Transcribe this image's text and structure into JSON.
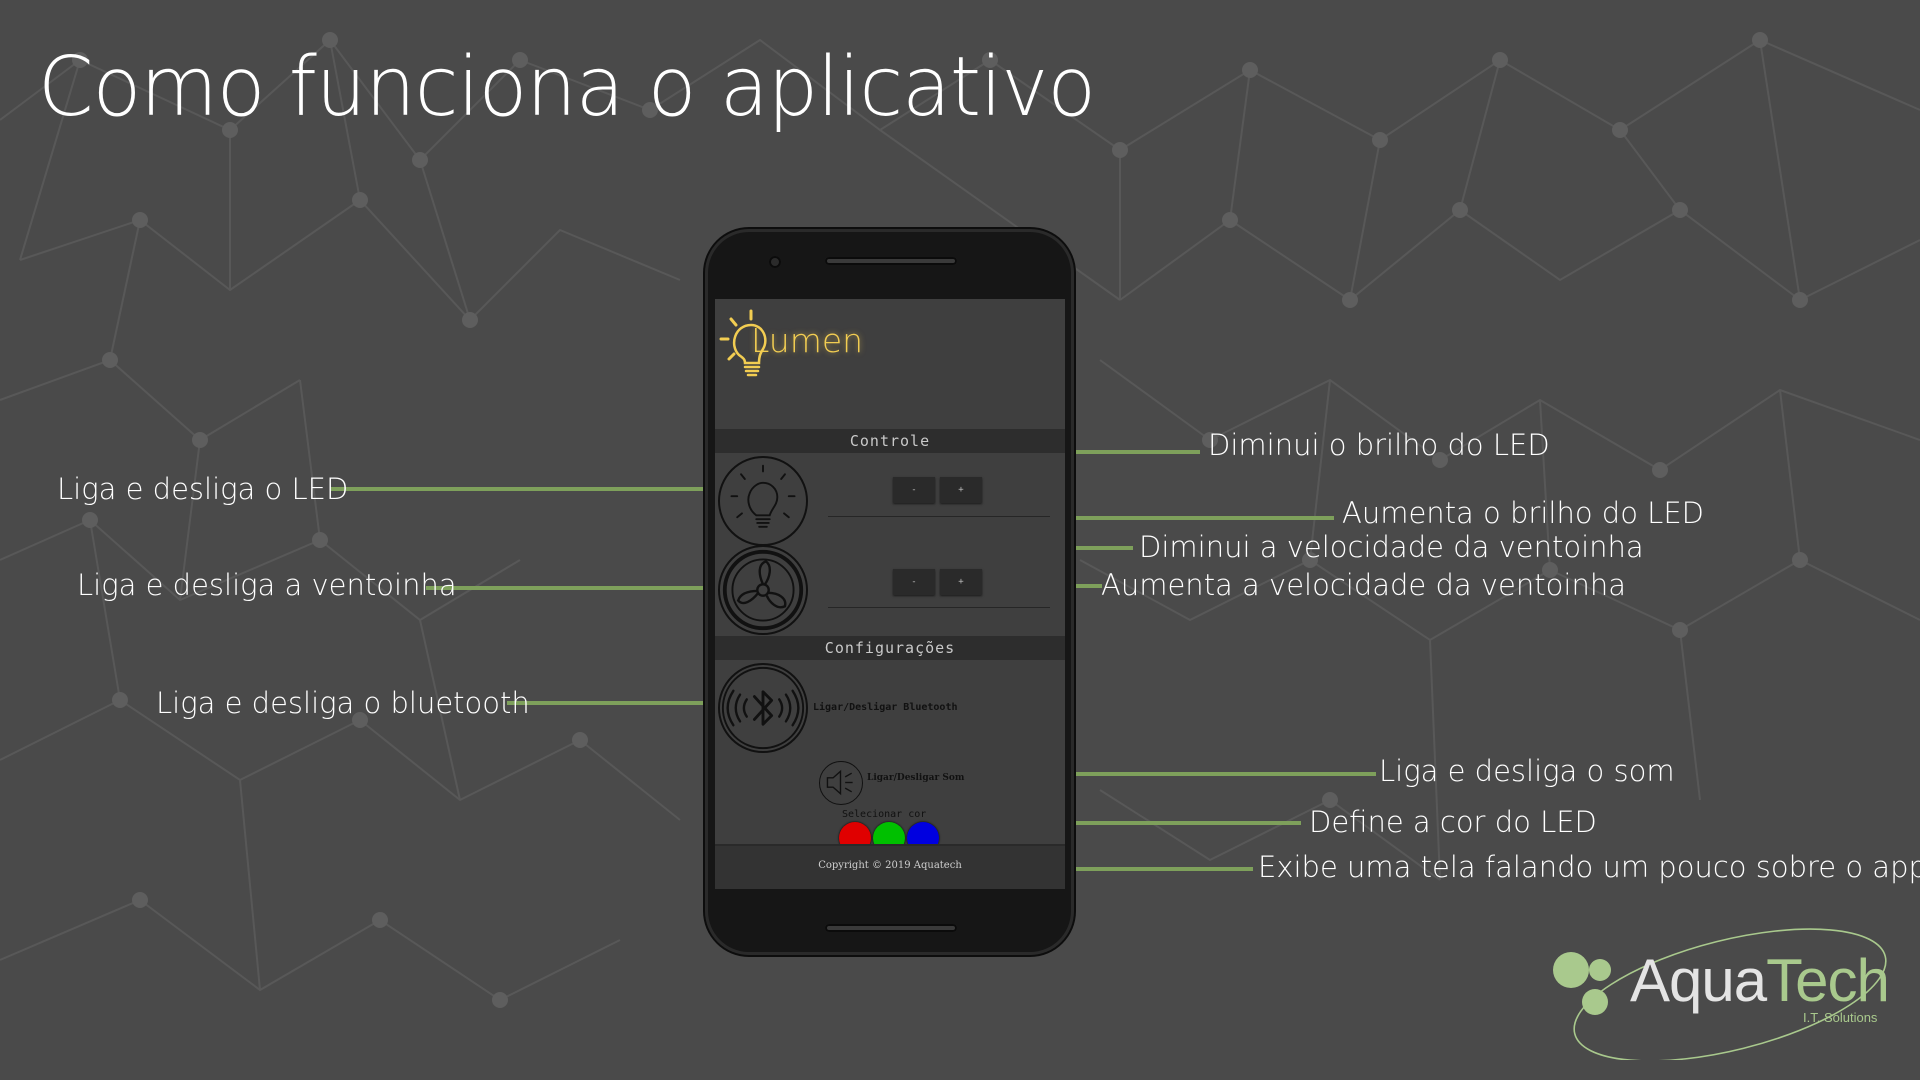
{
  "slide": {
    "title": "Como funciona o aplicativo",
    "accent_color": "#7ea05b"
  },
  "annotations": {
    "led_toggle": "Liga e desliga o LED",
    "fan_toggle": "Liga e desliga a ventoinha",
    "bluetooth_toggle": "Liga e desliga o bluetooth",
    "led_decrease": "Diminui o brilho do LED",
    "led_increase": "Aumenta o brilho do LED",
    "fan_decrease": "Diminui a velocidade da ventoinha",
    "fan_increase": "Aumenta a velocidade da ventoinha",
    "sound_toggle": "Liga e desliga o som",
    "color_select": "Define a cor do LED",
    "about_screen": "Exibe uma tela falando um pouco sobre o app"
  },
  "app": {
    "name": "Lumen",
    "logo_color": "#f2cd52",
    "sections": {
      "control": "Controle",
      "settings": "Configurações"
    },
    "led_buttons": {
      "minus": "-",
      "plus": "+"
    },
    "fan_buttons": {
      "minus": "-",
      "plus": "+"
    },
    "bluetooth_label": "Ligar/Desligar Bluetooth",
    "sound_label": "Ligar/Desligar Som",
    "color_label": "Selecionar cor",
    "colors": [
      "#e00000",
      "#00c000",
      "#0000e0"
    ],
    "footer": "Copyright © 2019 Aquatech",
    "icons": [
      "lightbulb-icon",
      "fan-icon",
      "bluetooth-icon",
      "speaker-icon"
    ]
  },
  "brand": {
    "name_part1": "Aqua",
    "name_part2": "Tech",
    "tagline": "I.T. Solutions",
    "color": "#a9c98d"
  }
}
